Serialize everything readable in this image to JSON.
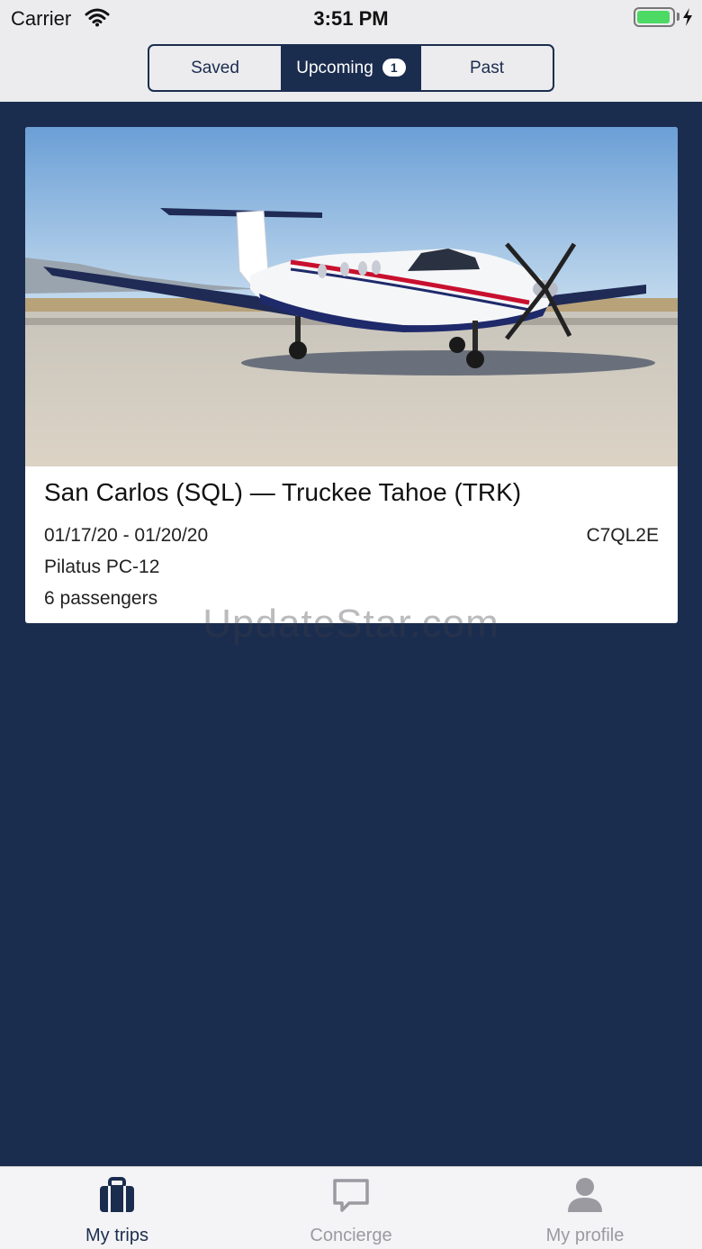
{
  "status_bar": {
    "carrier": "Carrier",
    "time": "3:51 PM",
    "wifi_icon": "wifi-icon",
    "battery_icon": "battery-charging-icon"
  },
  "segments": {
    "saved": "Saved",
    "upcoming": "Upcoming",
    "upcoming_count": "1",
    "past": "Past",
    "selected": "Upcoming"
  },
  "trip": {
    "route": "San Carlos (SQL) — Truckee Tahoe (TRK)",
    "dates": "01/17/20 - 01/20/20",
    "confirmation": "C7QL2E",
    "aircraft": "Pilatus PC-12",
    "passengers": "6 passengers"
  },
  "watermark": "UpdateStar.com",
  "tabbar": {
    "trips": {
      "label": "My trips",
      "icon": "briefcase-icon"
    },
    "concierge": {
      "label": "Concierge",
      "icon": "chat-bubble-icon"
    },
    "profile": {
      "label": "My profile",
      "icon": "person-icon"
    }
  },
  "colors": {
    "navy": "#1b2d4f",
    "header_bg": "#ececee",
    "battery_green": "#4cd964",
    "tab_inactive": "#9a9aa0"
  }
}
